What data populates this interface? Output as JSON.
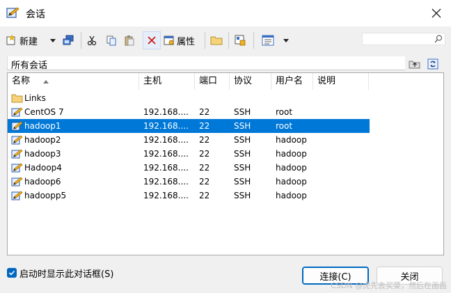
{
  "window": {
    "title": "会话"
  },
  "toolbar": {
    "new_label": "新建",
    "properties_label": "属性"
  },
  "path_bar": {
    "text": "所有会话"
  },
  "columns": [
    "名称",
    "主机",
    "端口",
    "协议",
    "用户名",
    "说明"
  ],
  "sessions": [
    {
      "name": "Links",
      "host": "",
      "port": "",
      "protocol": "",
      "user": "",
      "type": "folder"
    },
    {
      "name": "CentOS 7",
      "host": "192.168....",
      "port": "22",
      "protocol": "SSH",
      "user": "root",
      "type": "session"
    },
    {
      "name": "hadoop1",
      "host": "192.168....",
      "port": "22",
      "protocol": "SSH",
      "user": "root",
      "type": "session",
      "selected": true
    },
    {
      "name": "hadoop2",
      "host": "192.168....",
      "port": "22",
      "protocol": "SSH",
      "user": "hadoop",
      "type": "session"
    },
    {
      "name": "hadoop3",
      "host": "192.168....",
      "port": "22",
      "protocol": "SSH",
      "user": "hadoop",
      "type": "session"
    },
    {
      "name": "Hadoop4",
      "host": "192.168....",
      "port": "22",
      "protocol": "SSH",
      "user": "hadoop",
      "type": "session"
    },
    {
      "name": "hadoop6",
      "host": "192.168....",
      "port": "22",
      "protocol": "SSH",
      "user": "hadoop",
      "type": "session"
    },
    {
      "name": "hadoopp5",
      "host": "192.168....",
      "port": "22",
      "protocol": "SSH",
      "user": "hadoop",
      "type": "session"
    }
  ],
  "footer": {
    "show_on_startup_label": "启动时显示此对话框(S)",
    "show_on_startup_checked": true,
    "connect_label": "连接(C)",
    "close_label": "关闭"
  },
  "watermark": "CSDN @虎先去买菜，然后在画画",
  "colors": {
    "selection": "#0078d7",
    "checkbox": "#0067c0"
  }
}
